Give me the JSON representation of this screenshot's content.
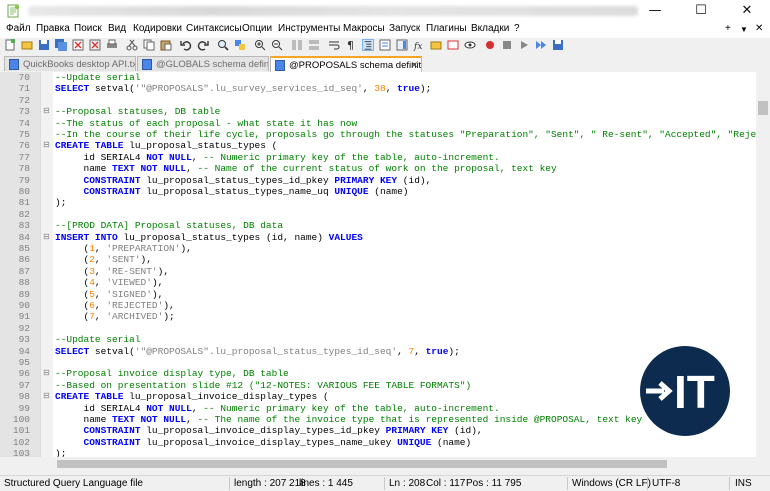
{
  "window": {
    "minimize": "—",
    "maximize": "☐",
    "close": "✕"
  },
  "menu": {
    "items": [
      "Файл",
      "Правка",
      "Поиск",
      "Вид",
      "Кодировки",
      "Синтаксисы",
      "Опции",
      "Инструменты",
      "Макросы",
      "Запуск",
      "Плагины",
      "Вкладки",
      "?"
    ],
    "right_plus": "+",
    "right_arrow": "▼",
    "right_close": "✕"
  },
  "tabs": [
    {
      "label": "QuickBooks desktop API.txt",
      "close": "✕",
      "active": false
    },
    {
      "label": "@GLOBALS schema definition.sql",
      "close": "✕",
      "active": false
    },
    {
      "label": "@PROPOSALS schema definition.sql",
      "close": "✕",
      "active": true
    }
  ],
  "lines": [
    {
      "n": "70",
      "fm": "",
      "segs": [
        [
          "cm",
          "--Update serial"
        ]
      ]
    },
    {
      "n": "71",
      "fm": "",
      "segs": [
        [
          "kw",
          "SELECT"
        ],
        [
          "pl",
          " setval("
        ],
        [
          "str",
          "'\"@PROPOSALS\".lu_survey_services_id_seq'"
        ],
        [
          "pl",
          ", "
        ],
        [
          "num",
          "38"
        ],
        [
          "pl",
          ", "
        ],
        [
          "kw",
          "true"
        ],
        [
          "pl",
          ");"
        ]
      ]
    },
    {
      "n": "72",
      "fm": "",
      "segs": []
    },
    {
      "n": "73",
      "fm": "⊟",
      "segs": [
        [
          "cm",
          "--Proposal statuses, DB table"
        ]
      ]
    },
    {
      "n": "74",
      "fm": "",
      "segs": [
        [
          "cm",
          "--The status of each proposal - what state it has now"
        ]
      ]
    },
    {
      "n": "75",
      "fm": "",
      "segs": [
        [
          "cm",
          "--In the course of their life cycle, proposals go through the statuses \"Preparation\", \"Sent\", \" Re-sent\", \"Accepted\", \"Rejec"
        ]
      ]
    },
    {
      "n": "76",
      "fm": "⊟",
      "segs": [
        [
          "kw",
          "CREATE TABLE"
        ],
        [
          "pl",
          " lu_proposal_status_types ("
        ]
      ]
    },
    {
      "n": "77",
      "fm": "",
      "segs": [
        [
          "pl",
          "     id SERIAL4 "
        ],
        [
          "kw",
          "NOT NULL"
        ],
        [
          "pl",
          ", "
        ],
        [
          "cm",
          "-- Numeric primary key of the table, auto-increment."
        ]
      ]
    },
    {
      "n": "78",
      "fm": "",
      "segs": [
        [
          "pl",
          "     name "
        ],
        [
          "kw",
          "TEXT NOT NULL"
        ],
        [
          "pl",
          ", "
        ],
        [
          "cm",
          "-- Name of the current status of work on the proposal, text key"
        ]
      ]
    },
    {
      "n": "79",
      "fm": "",
      "segs": [
        [
          "pl",
          "     "
        ],
        [
          "kw",
          "CONSTRAINT"
        ],
        [
          "pl",
          " lu_proposal_status_types_id_pkey "
        ],
        [
          "kw",
          "PRIMARY KEY"
        ],
        [
          "pl",
          " (id),"
        ]
      ]
    },
    {
      "n": "80",
      "fm": "",
      "segs": [
        [
          "pl",
          "     "
        ],
        [
          "kw",
          "CONSTRAINT"
        ],
        [
          "pl",
          " lu_proposal_status_types_name_uq "
        ],
        [
          "kw",
          "UNIQUE"
        ],
        [
          "pl",
          " (name)"
        ]
      ]
    },
    {
      "n": "81",
      "fm": "",
      "segs": [
        [
          "pl",
          ");"
        ]
      ]
    },
    {
      "n": "82",
      "fm": "",
      "segs": []
    },
    {
      "n": "83",
      "fm": "",
      "segs": [
        [
          "cm",
          "--[PROD DATA] Proposal statuses, DB data"
        ]
      ]
    },
    {
      "n": "84",
      "fm": "⊟",
      "segs": [
        [
          "kw",
          "INSERT INTO"
        ],
        [
          "pl",
          " lu_proposal_status_types (id, name) "
        ],
        [
          "kw",
          "VALUES"
        ]
      ]
    },
    {
      "n": "85",
      "fm": "",
      "segs": [
        [
          "pl",
          "     ("
        ],
        [
          "num",
          "1"
        ],
        [
          "pl",
          ", "
        ],
        [
          "str",
          "'PREPARATION'"
        ],
        [
          "pl",
          "),"
        ]
      ]
    },
    {
      "n": "86",
      "fm": "",
      "segs": [
        [
          "pl",
          "     ("
        ],
        [
          "num",
          "2"
        ],
        [
          "pl",
          ", "
        ],
        [
          "str",
          "'SENT'"
        ],
        [
          "pl",
          "),"
        ]
      ]
    },
    {
      "n": "87",
      "fm": "",
      "segs": [
        [
          "pl",
          "     ("
        ],
        [
          "num",
          "3"
        ],
        [
          "pl",
          ", "
        ],
        [
          "str",
          "'RE-SENT'"
        ],
        [
          "pl",
          "),"
        ]
      ]
    },
    {
      "n": "88",
      "fm": "",
      "segs": [
        [
          "pl",
          "     ("
        ],
        [
          "num",
          "4"
        ],
        [
          "pl",
          ", "
        ],
        [
          "str",
          "'VIEWED'"
        ],
        [
          "pl",
          "),"
        ]
      ]
    },
    {
      "n": "89",
      "fm": "",
      "segs": [
        [
          "pl",
          "     ("
        ],
        [
          "num",
          "5"
        ],
        [
          "pl",
          ", "
        ],
        [
          "str",
          "'SIGNED'"
        ],
        [
          "pl",
          "),"
        ]
      ]
    },
    {
      "n": "90",
      "fm": "",
      "segs": [
        [
          "pl",
          "     ("
        ],
        [
          "num",
          "6"
        ],
        [
          "pl",
          ", "
        ],
        [
          "str",
          "'REJECTED'"
        ],
        [
          "pl",
          "),"
        ]
      ]
    },
    {
      "n": "91",
      "fm": "",
      "segs": [
        [
          "pl",
          "     ("
        ],
        [
          "num",
          "7"
        ],
        [
          "pl",
          ", "
        ],
        [
          "str",
          "'ARCHIVED'"
        ],
        [
          "pl",
          ");"
        ]
      ]
    },
    {
      "n": "92",
      "fm": "",
      "segs": []
    },
    {
      "n": "93",
      "fm": "",
      "segs": [
        [
          "cm",
          "--Update serial"
        ]
      ]
    },
    {
      "n": "94",
      "fm": "",
      "segs": [
        [
          "kw",
          "SELECT"
        ],
        [
          "pl",
          " setval("
        ],
        [
          "str",
          "'\"@PROPOSALS\".lu_proposal_status_types_id_seq'"
        ],
        [
          "pl",
          ", "
        ],
        [
          "num",
          "7"
        ],
        [
          "pl",
          ", "
        ],
        [
          "kw",
          "true"
        ],
        [
          "pl",
          ");"
        ]
      ]
    },
    {
      "n": "95",
      "fm": "",
      "segs": []
    },
    {
      "n": "96",
      "fm": "⊟",
      "segs": [
        [
          "cm",
          "--Proposal invoice display type, DB table"
        ]
      ]
    },
    {
      "n": "97",
      "fm": "",
      "segs": [
        [
          "cm",
          "--Based on presentation slide #12 (\"12-NOTES: VARIOUS FEE TABLE FORMATS\")"
        ]
      ]
    },
    {
      "n": "98",
      "fm": "⊟",
      "segs": [
        [
          "kw",
          "CREATE TABLE"
        ],
        [
          "pl",
          " lu_proposal_invoice_display_types ("
        ]
      ]
    },
    {
      "n": "99",
      "fm": "",
      "segs": [
        [
          "pl",
          "     id SERIAL4 "
        ],
        [
          "kw",
          "NOT NULL"
        ],
        [
          "pl",
          ", "
        ],
        [
          "cm",
          "-- Numeric primary key of the table, auto-increment."
        ]
      ]
    },
    {
      "n": "100",
      "fm": "",
      "segs": [
        [
          "pl",
          "     name "
        ],
        [
          "kw",
          "TEXT NOT NULL"
        ],
        [
          "pl",
          ", "
        ],
        [
          "cm",
          "-- The name of the invoice type that is represented inside @PROPOSAL, text key"
        ]
      ]
    },
    {
      "n": "101",
      "fm": "",
      "segs": [
        [
          "pl",
          "     "
        ],
        [
          "kw",
          "CONSTRAINT"
        ],
        [
          "pl",
          " lu_proposal_invoice_display_types_id_pkey "
        ],
        [
          "kw",
          "PRIMARY KEY"
        ],
        [
          "pl",
          " (id),"
        ]
      ]
    },
    {
      "n": "102",
      "fm": "",
      "segs": [
        [
          "pl",
          "     "
        ],
        [
          "kw",
          "CONSTRAINT"
        ],
        [
          "pl",
          " lu_proposal_invoice_display_types_name_ukey "
        ],
        [
          "kw",
          "UNIQUE"
        ],
        [
          "pl",
          " (name)"
        ]
      ]
    },
    {
      "n": "103",
      "fm": "",
      "segs": [
        [
          "pl",
          ");"
        ]
      ]
    }
  ],
  "status": {
    "filetype": "Structured Query Language file",
    "length": "length : 207 218",
    "lines": "lines : 1 445",
    "ln": "Ln : 208",
    "col": "Col : 117",
    "pos": "Pos : 11 795",
    "eol": "Windows (CR LF)",
    "encoding": "UTF-8",
    "mode": "INS"
  },
  "logo": {
    "text": "IT",
    "arrow": "→"
  },
  "colors": {
    "keyword": "#0000ff",
    "comment": "#008000",
    "string": "#808080",
    "number": "#ff8000",
    "logo_bg": "#0d2a4f",
    "active_tab_accent": "#f5a623"
  }
}
